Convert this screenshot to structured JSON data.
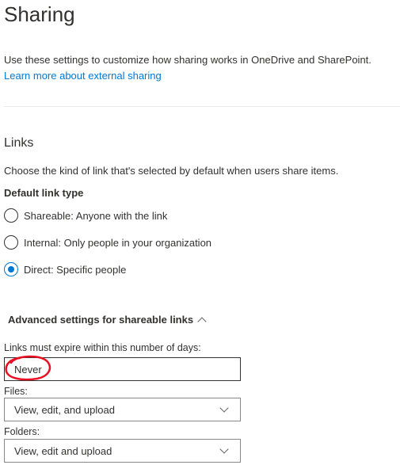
{
  "page": {
    "title": "Sharing",
    "intro": "Use these settings to customize how sharing works in OneDrive and SharePoint.",
    "learn_more_link": "Learn more about external sharing"
  },
  "links_section": {
    "heading": "Links",
    "description": "Choose the kind of link that's selected by default when users share items.",
    "default_link_type_label": "Default link type",
    "options": [
      {
        "label": "Shareable: Anyone with the link",
        "checked": false
      },
      {
        "label": "Internal: Only people in your organization",
        "checked": false
      },
      {
        "label": "Direct: Specific people",
        "checked": true
      }
    ]
  },
  "advanced": {
    "toggle_label": "Advanced settings for shareable links",
    "expire_label": "Links must expire within this number of days:",
    "expire_value": "Never",
    "files_label": "Files:",
    "files_value": "View, edit, and upload",
    "folders_label": "Folders:",
    "folders_value": "View, edit and upload"
  },
  "colors": {
    "accent": "#0078d4",
    "annotation": "#e81123"
  }
}
